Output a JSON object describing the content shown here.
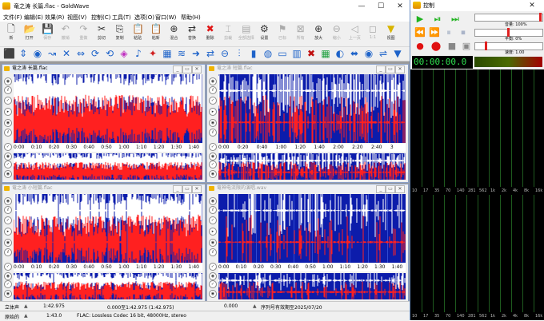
{
  "main_window": {
    "title": "竜之涛 长篇.flac - GoldWave",
    "menu": [
      "文件(F)",
      "编辑(E)",
      "效果(R)",
      "视图(V)",
      "控制(C)",
      "工具(T)",
      "选项(O)",
      "窗口(W)",
      "帮助(H)"
    ],
    "toolbar": [
      {
        "label": "新",
        "icon": "new-file-icon",
        "enabled": true
      },
      {
        "label": "打开",
        "icon": "open-folder-icon",
        "enabled": true
      },
      {
        "label": "保存",
        "icon": "save-icon",
        "enabled": false
      },
      {
        "label": "撤销",
        "icon": "undo-icon",
        "enabled": false
      },
      {
        "label": "重做",
        "icon": "redo-icon",
        "enabled": false
      },
      {
        "label": "剪切",
        "icon": "scissors-icon",
        "enabled": true
      },
      {
        "label": "复制",
        "icon": "copy-icon",
        "enabled": true
      },
      {
        "label": "粘贴",
        "icon": "paste-icon",
        "enabled": true
      },
      {
        "label": "粘新",
        "icon": "paste-new-icon",
        "enabled": true
      },
      {
        "label": "混合",
        "icon": "mix-icon",
        "enabled": true
      },
      {
        "label": "替换",
        "icon": "replace-icon",
        "enabled": true
      },
      {
        "label": "删除",
        "icon": "delete-icon",
        "enabled": true
      },
      {
        "label": "剪裁",
        "icon": "trim-icon",
        "enabled": false
      },
      {
        "label": "全部选择",
        "icon": "select-all-icon",
        "enabled": false
      },
      {
        "label": "设置",
        "icon": "settings-icon",
        "enabled": true
      },
      {
        "label": "已标",
        "icon": "marker-icon",
        "enabled": false
      },
      {
        "label": "所有",
        "icon": "all-icon",
        "enabled": false
      },
      {
        "label": "放大",
        "icon": "zoom-in-icon",
        "enabled": true
      },
      {
        "label": "缩小",
        "icon": "zoom-out-icon",
        "enabled": false
      },
      {
        "label": "上一页",
        "icon": "previous-icon",
        "enabled": false
      },
      {
        "label": "1:1",
        "icon": "actual-size-icon",
        "enabled": false
      },
      {
        "label": "视图",
        "icon": "view-icon",
        "enabled": true
      }
    ],
    "sub_windows": [
      {
        "title": "竜之涛 长篇.flac",
        "active": true,
        "ticks": [
          "0:00",
          "0:10",
          "0:20",
          "0:30",
          "0:40",
          "0:50",
          "1:00",
          "1:10",
          "1:20",
          "1:30",
          "1:40"
        ],
        "density": 0.95
      },
      {
        "title": "竜之涛 短篇.flac",
        "active": false,
        "ticks": [
          "0:00",
          "0:20",
          "0:40",
          "1:00",
          "1:20",
          "1:40",
          "2:00",
          "2:20",
          "2:40",
          "3"
        ],
        "density": 0.45
      },
      {
        "title": "竜之涛 小短篇.flac",
        "active": false,
        "ticks": [
          "0:00",
          "0:10",
          "0:20",
          "0:30",
          "0:40",
          "0:50",
          "1:00",
          "1:10",
          "1:20",
          "1:30",
          "1:40"
        ],
        "density": 0.9
      },
      {
        "title": "竜神电流限的演唱.wav",
        "active": false,
        "ticks": [
          "0:00",
          "0:10",
          "0:20",
          "0:30",
          "0:40",
          "0:50",
          "1:00",
          "1:10",
          "1:20",
          "1:30",
          "1:40"
        ],
        "density": 0.2
      }
    ],
    "status": {
      "channel": "立体声",
      "length": "1:42.975",
      "selection": "0.000至1:42.975 (1:42.975)",
      "position": "0.000",
      "notice": "序列号有效期至2025/07/20",
      "mode": "原始的",
      "duration2": "1:43.0",
      "format": "FLAC: Lossless Codec 16 bit, 48000Hz, stereo"
    }
  },
  "control_window": {
    "title": "控制",
    "volume_label": "音量: 100%",
    "balance_label": "平衡: 0%",
    "speed_label": "速度: 1.00",
    "time": "00:00:00.0",
    "spectrum_axis": [
      "10",
      "17",
      "35",
      "70",
      "140",
      "281",
      "562",
      "1k",
      "2k",
      "4k",
      "8k",
      "16k"
    ],
    "colors": {
      "play": "#1fb21f",
      "record": "#e01010",
      "time_text": "#2fe04f",
      "wave_bg": "#0c1cab",
      "wave_left": "#ffffff",
      "wave_right": "#ff2020"
    }
  }
}
